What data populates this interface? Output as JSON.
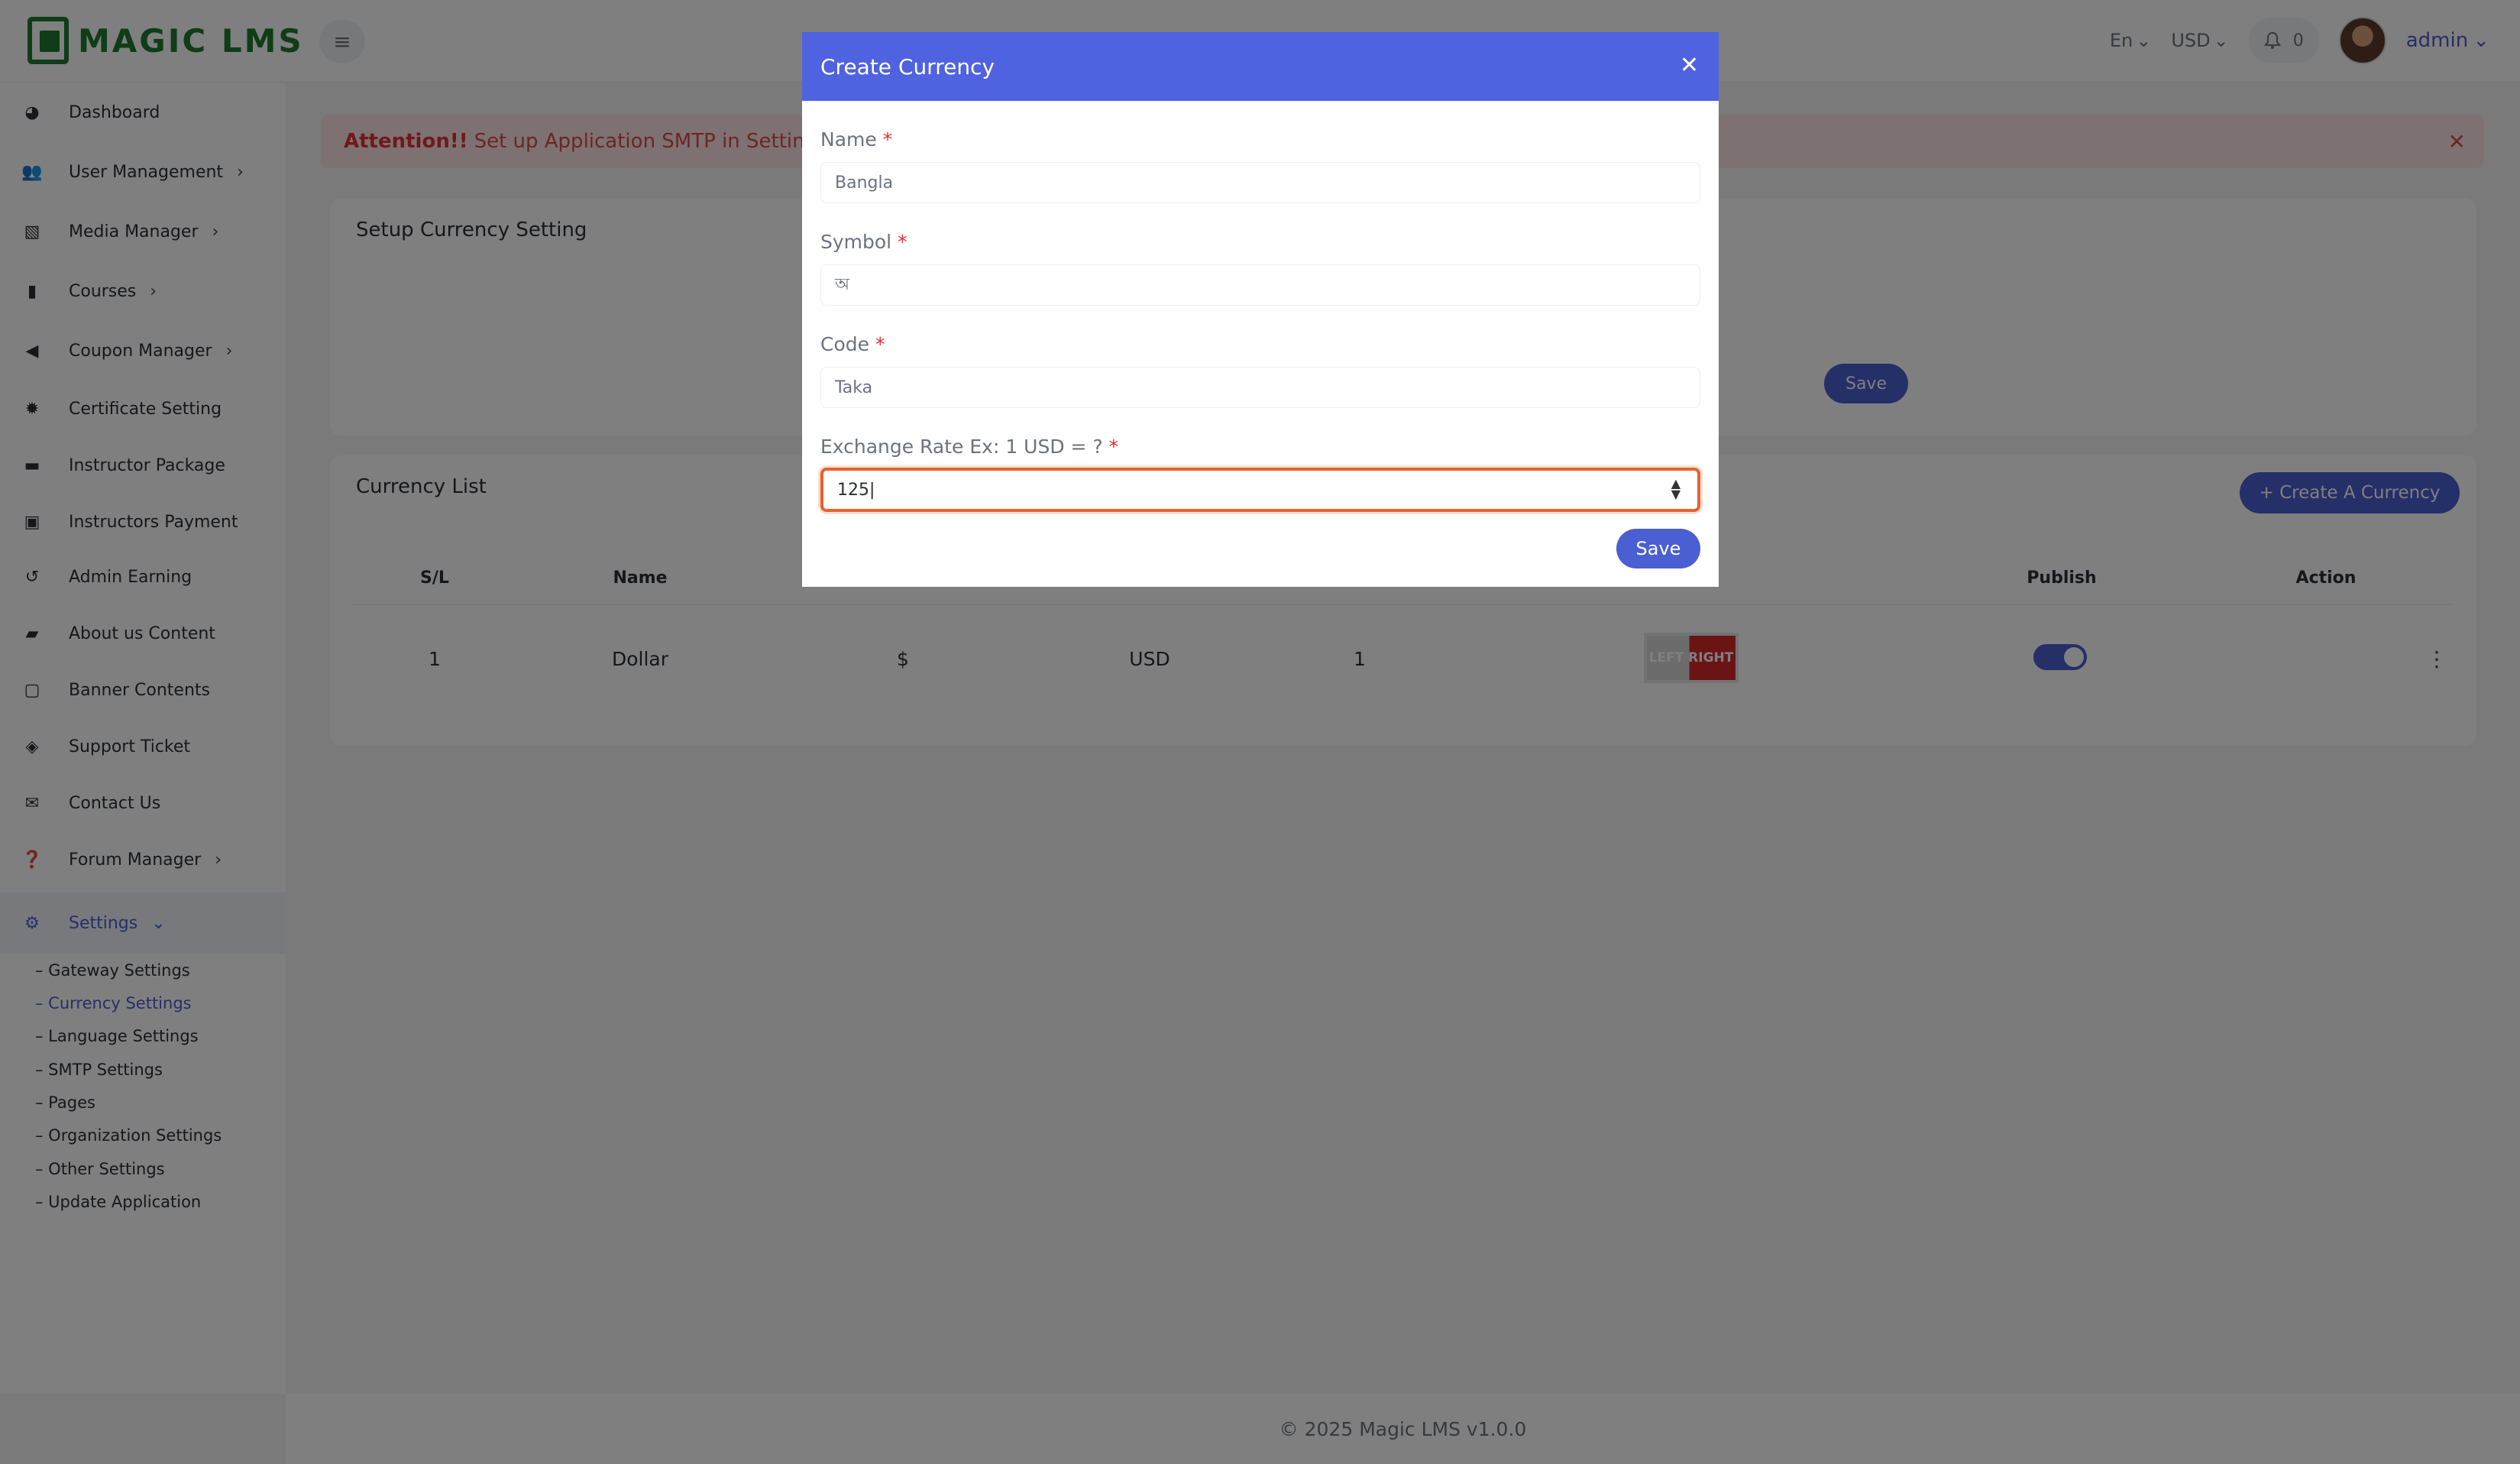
{
  "app": {
    "logo_text": "MAGIC LMS"
  },
  "topbar": {
    "language": "En",
    "currency": "USD",
    "notifications_count": "0",
    "user_name": "admin"
  },
  "sidebar": {
    "items": [
      {
        "label": "Dashboard",
        "icon": "dashboard-icon",
        "has_chevron": false
      },
      {
        "label": "User Management",
        "icon": "users-icon",
        "has_chevron": true
      },
      {
        "label": "Media Manager",
        "icon": "image-icon",
        "has_chevron": true
      },
      {
        "label": "Courses",
        "icon": "book-icon",
        "has_chevron": true
      },
      {
        "label": "Coupon Manager",
        "icon": "megaphone-icon",
        "has_chevron": true
      },
      {
        "label": "Certificate Setting",
        "icon": "certificate-icon",
        "has_chevron": false
      },
      {
        "label": "Instructor Package",
        "icon": "briefcase-icon",
        "has_chevron": false
      },
      {
        "label": "Instructors Payment",
        "icon": "money-icon",
        "has_chevron": false
      },
      {
        "label": "Admin Earning",
        "icon": "history-icon",
        "has_chevron": false
      },
      {
        "label": "About us Content",
        "icon": "file-icon",
        "has_chevron": false
      },
      {
        "label": "Banner Contents",
        "icon": "banner-icon",
        "has_chevron": false
      },
      {
        "label": "Support Ticket",
        "icon": "ticket-icon",
        "has_chevron": false
      },
      {
        "label": "Contact Us",
        "icon": "envelope-icon",
        "has_chevron": false
      },
      {
        "label": "Forum Manager",
        "icon": "question-icon",
        "has_chevron": true
      },
      {
        "label": "Settings",
        "icon": "gear-icon",
        "has_chevron": true
      }
    ],
    "settings_subitems": [
      "– Gateway Settings",
      "– Currency Settings",
      "– Language Settings",
      "– SMTP Settings",
      "– Pages",
      "– Organization Settings",
      "– Other Settings",
      "– Update Application"
    ]
  },
  "alert": {
    "strong": "Attention!!",
    "text": "Set up Application SMTP in Settings fo"
  },
  "setup_card": {
    "title": "Setup Currency Setting",
    "save_label": "Save"
  },
  "currency_list": {
    "title": "Currency List",
    "create_label": "+ Create A Currency",
    "headers": [
      "S/L",
      "Name",
      "Publish",
      "Action"
    ],
    "rows": [
      {
        "sl": "1",
        "name": "Dollar",
        "symbol": "$",
        "code": "USD",
        "rate": "1",
        "flag_text": "LEFT RIGHT"
      }
    ]
  },
  "modal": {
    "title": "Create Currency",
    "fields": [
      {
        "label": "Name",
        "value": "Bangla"
      },
      {
        "label": "Symbol",
        "value": "অ"
      },
      {
        "label": "Code",
        "value": "Taka"
      },
      {
        "label": "Exchange Rate Ex: 1 USD = ?",
        "value": "125"
      }
    ],
    "required_mark": "*",
    "save_label": "Save"
  },
  "footer": {
    "text": "© 2025 Magic LMS v1.0.0"
  }
}
